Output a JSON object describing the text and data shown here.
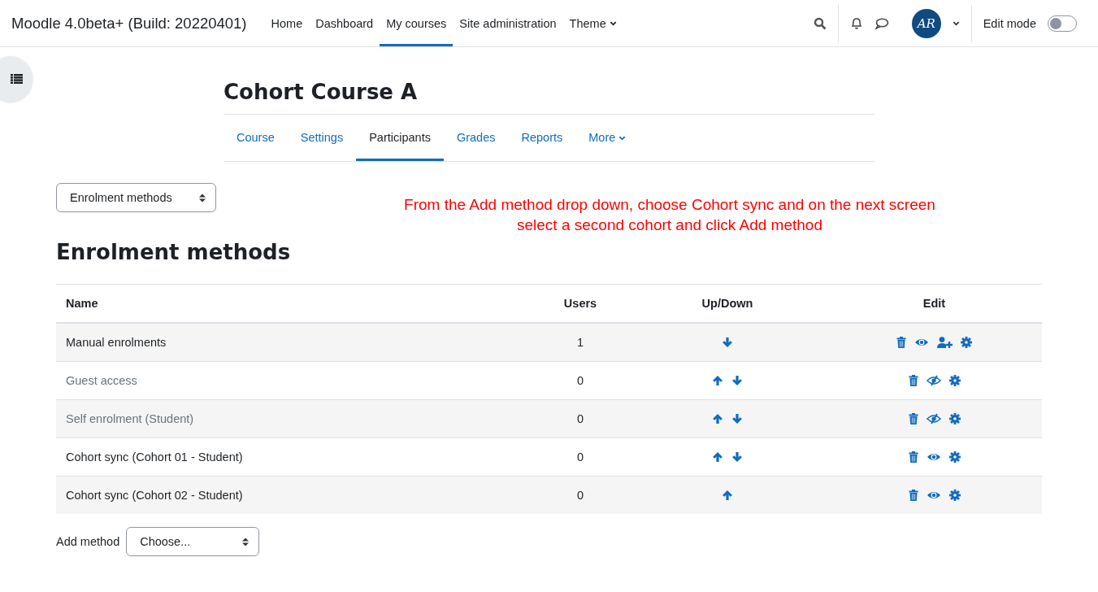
{
  "navbar": {
    "site_name": "Moodle 4.0beta+ (Build: 20220401)",
    "links": [
      {
        "label": "Home",
        "selected": false,
        "dropdown": false
      },
      {
        "label": "Dashboard",
        "selected": false,
        "dropdown": false
      },
      {
        "label": "My courses",
        "selected": true,
        "dropdown": false
      },
      {
        "label": "Site administration",
        "selected": false,
        "dropdown": false
      },
      {
        "label": "Theme",
        "selected": false,
        "dropdown": true
      }
    ],
    "avatar_initials": "AR",
    "edit_mode": {
      "label": "Edit mode",
      "on": false
    }
  },
  "course": {
    "title": "Cohort Course A",
    "tabs": [
      {
        "label": "Course",
        "selected": false,
        "dropdown": false
      },
      {
        "label": "Settings",
        "selected": false,
        "dropdown": false
      },
      {
        "label": "Participants",
        "selected": true,
        "dropdown": false
      },
      {
        "label": "Grades",
        "selected": false,
        "dropdown": false
      },
      {
        "label": "Reports",
        "selected": false,
        "dropdown": false
      },
      {
        "label": "More",
        "selected": false,
        "dropdown": true
      }
    ]
  },
  "page_select": {
    "value": "Enrolment methods"
  },
  "annotation": "From the Add method drop down, choose Cohort sync and on the next screen select a second cohort and click Add method",
  "heading": "Enrolment methods",
  "table": {
    "columns": [
      "Name",
      "Users",
      "Up/Down",
      "Edit"
    ],
    "rows": [
      {
        "name": "Manual enrolments",
        "users": "1",
        "disabled": false,
        "can_move_up": false,
        "can_move_down": true,
        "can_enrol_users": true
      },
      {
        "name": "Guest access",
        "users": "0",
        "disabled": true,
        "can_move_up": true,
        "can_move_down": true,
        "can_enrol_users": false
      },
      {
        "name": "Self enrolment (Student)",
        "users": "0",
        "disabled": true,
        "can_move_up": true,
        "can_move_down": true,
        "can_enrol_users": false
      },
      {
        "name": "Cohort sync (Cohort 01 - Student)",
        "users": "0",
        "disabled": false,
        "can_move_up": true,
        "can_move_down": true,
        "can_enrol_users": false
      },
      {
        "name": "Cohort sync (Cohort 02 - Student)",
        "users": "0",
        "disabled": false,
        "can_move_up": true,
        "can_move_down": false,
        "can_enrol_users": false
      }
    ]
  },
  "add_method": {
    "label": "Add method",
    "value": "Choose..."
  }
}
